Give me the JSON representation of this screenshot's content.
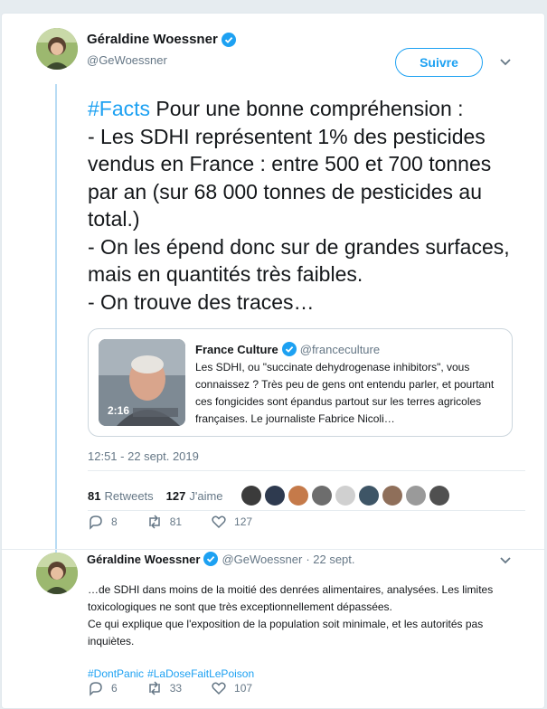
{
  "tweet": {
    "author": {
      "name": "Géraldine Woessner",
      "handle": "@GeWoessner"
    },
    "follow_label": "Suivre",
    "text": {
      "hashtag": "#Facts",
      "lines": [
        " Pour une bonne compréhension :",
        "- Les SDHI représentent 1% des pesticides vendus en France : entre 500 et 700 tonnes par an (sur 68 000 tonnes de pesticides au total.)",
        "- On les épend donc sur de grandes surfaces, mais en quantités très faibles.",
        "- On trouve des traces…"
      ]
    },
    "quote": {
      "name": "France Culture",
      "handle": "@franceculture",
      "text": "Les SDHI, ou \"succinate dehydrogenase inhibitors\", vous connaissez ? Très peu de gens ont entendu parler, et pourtant ces fongicides sont épandus partout sur les terres agricoles françaises. Le journaliste Fabrice Nicoli…",
      "video_duration": "2:16"
    },
    "timestamp": "12:51 - 22 sept. 2019",
    "stats": {
      "retweets": "81",
      "retweets_label": "Retweets",
      "likes": "127",
      "likes_label": "J'aime"
    },
    "actions": {
      "replies": "8",
      "retweets": "81",
      "likes": "127"
    }
  },
  "reply": {
    "author": {
      "name": "Géraldine Woessner",
      "handle": "@GeWoessner",
      "date": "· 22 sept."
    },
    "text_lines": [
      "…de SDHI dans moins de la moitié des denrées alimentaires, analysées. Les limites toxicologiques ne sont que très exceptionnellement dépassées.",
      "Ce qui explique que l'exposition de la population soit minimale, et les autorités pas inquiètes."
    ],
    "hashtags": [
      "#DontPanic",
      "#LaDoseFaitLePoison"
    ],
    "actions": {
      "replies": "6",
      "retweets": "33",
      "likes": "107"
    }
  },
  "colors": {
    "accent": "#1da1f2",
    "text": "#14171a",
    "muted": "#657786",
    "thread_line": "#b9dcf4",
    "background": "#e6ecf0"
  }
}
